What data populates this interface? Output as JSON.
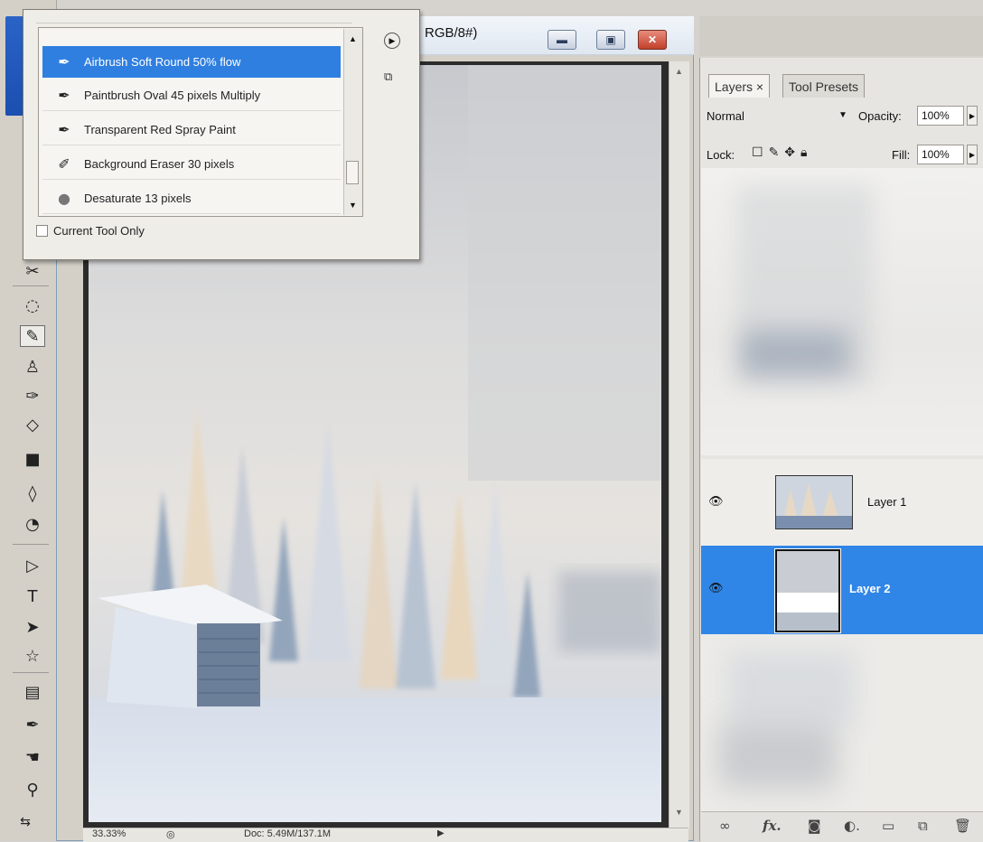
{
  "tools": {
    "items": [
      {
        "name": "heal-brush-tool-icon",
        "glyph": "✂"
      },
      {
        "name": "lasso-tool-icon",
        "glyph": "◌"
      },
      {
        "name": "brush-tool-icon",
        "glyph": "✎"
      },
      {
        "name": "clone-stamp-tool-icon",
        "glyph": "♙"
      },
      {
        "name": "history-brush-tool-icon",
        "glyph": "✑"
      },
      {
        "name": "eraser-tool-icon",
        "glyph": "◇"
      },
      {
        "name": "gradient-tool-icon",
        "glyph": "■"
      },
      {
        "name": "blur-tool-icon",
        "glyph": "◊"
      },
      {
        "name": "dodge-tool-icon",
        "glyph": "◔"
      },
      {
        "name": "path-selection-tool-icon",
        "glyph": "▷"
      },
      {
        "name": "type-tool-icon",
        "glyph": "T"
      },
      {
        "name": "direct-selection-tool-icon",
        "glyph": "➤"
      },
      {
        "name": "custom-shape-tool-icon",
        "glyph": "☆"
      },
      {
        "name": "notes-tool-icon",
        "glyph": "▤"
      },
      {
        "name": "eyedropper-tool-icon",
        "glyph": "✒"
      },
      {
        "name": "hand-tool-icon",
        "glyph": "☚"
      },
      {
        "name": "zoom-tool-icon",
        "glyph": "⚲"
      },
      {
        "name": "swap-colors-icon",
        "glyph": "⇆"
      }
    ],
    "active": "brush-tool-icon"
  },
  "document": {
    "title": "RGB/8#)",
    "status_zoom": "33.33%",
    "status_doc": "Doc: 5.49M/137.1M"
  },
  "preset_popup": {
    "items": [
      {
        "label": "Airbrush Soft Round 50% flow",
        "icon": "brush-icon",
        "glyph": "✒",
        "selected": true
      },
      {
        "label": "Paintbrush Oval 45 pixels Multiply",
        "icon": "brush-icon",
        "glyph": "✒",
        "selected": false
      },
      {
        "label": "Transparent Red Spray Paint",
        "icon": "brush-icon",
        "glyph": "✒",
        "selected": false
      },
      {
        "label": "Background Eraser 30 pixels",
        "icon": "background-eraser-icon",
        "glyph": "✐",
        "selected": false
      },
      {
        "label": "Desaturate 13 pixels",
        "icon": "sponge-icon",
        "glyph": "●",
        "selected": false
      }
    ],
    "current_tool_only": "Current Tool Only"
  },
  "layers_panel": {
    "tabs": [
      {
        "label": "Layers ×",
        "active": true
      },
      {
        "label": "Tool Presets",
        "active": false
      }
    ],
    "blend_mode": "Normal",
    "opacity_label": "Opacity:",
    "opacity": "100%",
    "lock_label": "Lock:",
    "fill_label": "Fill:",
    "fill": "100%",
    "layers": [
      {
        "name": "Layer 1",
        "visible": true,
        "selected": false
      },
      {
        "name": "Layer 2",
        "visible": true,
        "selected": true
      }
    ]
  },
  "colors": {
    "selection_blue": "#2f86e6",
    "window_close_red": "#c1402a",
    "panel_bg": "#e7e5e1"
  }
}
